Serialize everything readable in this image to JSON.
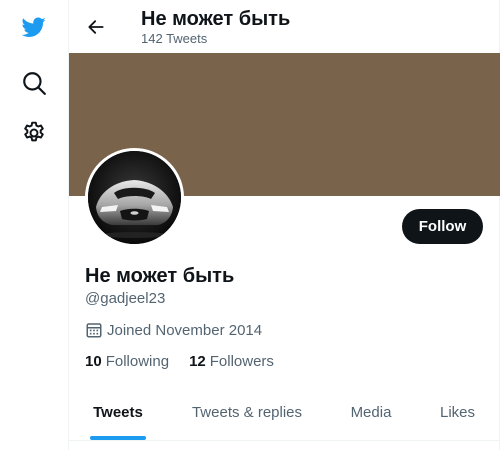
{
  "header": {
    "title": "Не может быть",
    "tweet_count": "142 Tweets"
  },
  "profile": {
    "name": "Не может быть",
    "handle": "@gadjeel23",
    "joined": "Joined November 2014",
    "follow_label": "Follow",
    "following_count": "10",
    "following_label": "Following",
    "followers_count": "12",
    "followers_label": "Followers",
    "banner_color": "#7a634b"
  },
  "tabs": [
    {
      "label": "Tweets",
      "active": true
    },
    {
      "label": "Tweets & replies",
      "active": false
    },
    {
      "label": "Media",
      "active": false
    },
    {
      "label": "Likes",
      "active": false
    }
  ],
  "colors": {
    "accent": "#1d9bf0",
    "text": "#0f1419",
    "muted": "#536471"
  },
  "icons": {
    "rail": [
      "twitter-bird-icon",
      "search-icon",
      "settings-gear-icon"
    ],
    "back": "back-arrow-icon",
    "calendar": "calendar-icon"
  }
}
